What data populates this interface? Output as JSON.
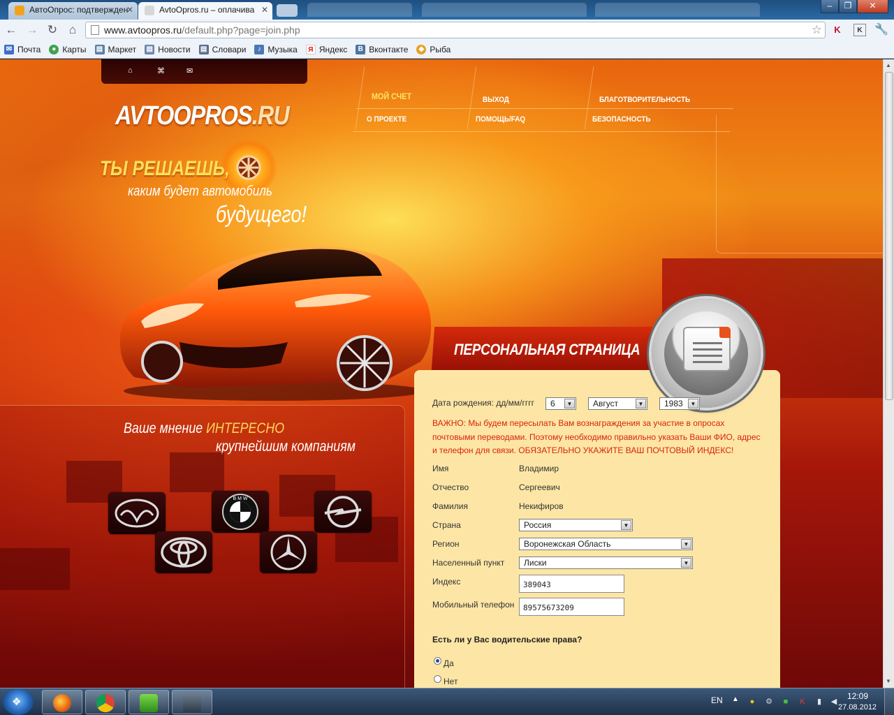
{
  "browser": {
    "tabs": [
      {
        "title": "АвтоОпрос: подтвержден",
        "active": false
      },
      {
        "title": "AvtoOpros.ru – оплачива",
        "active": true
      }
    ],
    "url_host": "www.avtoopros.ru",
    "url_path": "/default.php?page=join.php",
    "bookmarks": [
      "Почта",
      "Карты",
      "Маркет",
      "Новости",
      "Словари",
      "Музыка",
      "Яндекс",
      "Вконтакте",
      "Рыба"
    ]
  },
  "site": {
    "logo_main": "AVTOOPROS",
    "logo_tld": ".RU",
    "menu": {
      "account": "МОЙ СЧЕТ",
      "exit": "ВЫХОД",
      "charity": "БЛАГОТВОРИТЕЛЬНОСТЬ",
      "about": "О ПРОЕКТЕ",
      "help": "ПОМОЩЬ/FAQ",
      "security": "БЕЗОПАСНОСТЬ"
    },
    "slogan": {
      "line1": "ТЫ РЕШАЕШЬ,",
      "line2": "каким будет автомобиль",
      "line3": "будущего!"
    },
    "opinion": {
      "part1": "Ваше мнение ",
      "highlight": "ИНТЕРЕСНО",
      "line2": "крупнейшим компаниям"
    },
    "brands": [
      "mazda",
      "bmw",
      "opel",
      "toyota",
      "mercedes-benz"
    ]
  },
  "form": {
    "title": "ПЕРСОНАЛЬНАЯ СТРАНИЦА",
    "birth_label": "Дата рождения: дд/мм/гггг",
    "birth_day": "6",
    "birth_month": "Август",
    "birth_year": "1983",
    "warning": "ВАЖНО: Мы будем пересылать Вам вознаграждения за участие в опросах почтовыми переводами. Поэтому необходимо правильно указать Ваши ФИО, адрес и телефон для связи. ОБЯЗАТЕЛЬНО УКАЖИТЕ ВАШ ПОЧТОВЫЙ ИНДЕКС!",
    "first_name_label": "Имя",
    "first_name": "Владимир",
    "patronymic_label": "Отчество",
    "patronymic": "Сергеевич",
    "last_name_label": "Фамилия",
    "last_name": "Некифиров",
    "country_label": "Страна",
    "country": "Россия",
    "region_label": "Регион",
    "region": "Воронежская Область",
    "city_label": "Населенный пункт",
    "city": "Лиски",
    "zip_label": "Индекс",
    "zip": "389043",
    "phone_label": "Мобильный телефон",
    "phone": "89575673209",
    "license_question": "Есть ли у Вас водительские права?",
    "license_yes": "Да",
    "license_no": "Нет",
    "license_selected": "Да"
  },
  "taskbar": {
    "lang": "EN",
    "time": "12:09",
    "date": "27.08.2012"
  },
  "colors": {
    "form_bg": "#fde6a5",
    "warning": "#d9220c",
    "menu_active": "#ffe36b"
  }
}
